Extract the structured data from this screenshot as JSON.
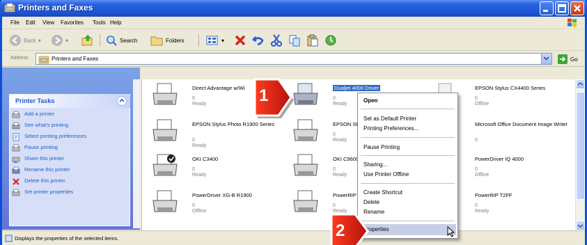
{
  "window": {
    "title": "Printers and Faxes",
    "accent": "#1d56d8"
  },
  "menu": [
    "File",
    "Edit",
    "View",
    "Favorites",
    "Tools",
    "Help"
  ],
  "toolbar": {
    "back": "Back",
    "search": "Search",
    "folders": "Folders"
  },
  "address": {
    "label": "Address",
    "value": "Printers and Faxes",
    "go": "Go"
  },
  "taskpane": {
    "header": "Printer Tasks",
    "items": [
      {
        "label": "Add a printer",
        "icon": "add-printer-icon"
      },
      {
        "label": "See what's printing",
        "icon": "printer-icon"
      },
      {
        "label": "Select printing preferences",
        "icon": "preferences-icon"
      },
      {
        "label": "Pause printing",
        "icon": "pause-icon"
      },
      {
        "label": "Share this printer",
        "icon": "share-icon"
      },
      {
        "label": "Rename this printer",
        "icon": "rename-icon"
      },
      {
        "label": "Delete this printer",
        "icon": "delete-icon"
      },
      {
        "label": "Set printer properties",
        "icon": "properties-icon"
      }
    ]
  },
  "printers": [
    {
      "name": "Direct Advantage w/Wi",
      "count": "0",
      "status": "Ready"
    },
    {
      "name": "Dualjet 4000 Driver",
      "count": "0",
      "status": "Ready"
    },
    {
      "name": "EPSON Stylus CX4400 Series",
      "count": "0",
      "status": "Offline"
    },
    {
      "name": "EPSON Stylus Photo R1900 Series",
      "count": "0",
      "status": "Ready"
    },
    {
      "name": "EPSON Styl",
      "count": "0",
      "status": "Ready"
    },
    {
      "name": "Microsoft Office Document Image Writer",
      "count": "0",
      "status": ""
    },
    {
      "name": "OKI C3400",
      "count": "0",
      "status": "Ready"
    },
    {
      "name": "OKI C9600",
      "count": "0",
      "status": "Ready"
    },
    {
      "name": "PowerDriver IQ 4000",
      "count": "0",
      "status": "Offline"
    },
    {
      "name": "PowerDriver XG-B R1900",
      "count": "0",
      "status": "Offline"
    },
    {
      "name": "PowerRIP F",
      "count": "0",
      "status": "Ready"
    },
    {
      "name": "PowerRIP T2FF",
      "count": "0",
      "status": "Ready"
    }
  ],
  "context_menu": {
    "open": "Open",
    "set_default": "Set as Default Printer",
    "preferences": "Printing Preferences...",
    "pause": "Pause Printing",
    "sharing": "Sharing...",
    "offline": "Use Printer Offline",
    "shortcut": "Create Shortcut",
    "delete": "Delete",
    "rename": "Rename",
    "properties": "Properties"
  },
  "callouts": [
    "1",
    "2"
  ],
  "status": "Displays the properties of the selected items."
}
